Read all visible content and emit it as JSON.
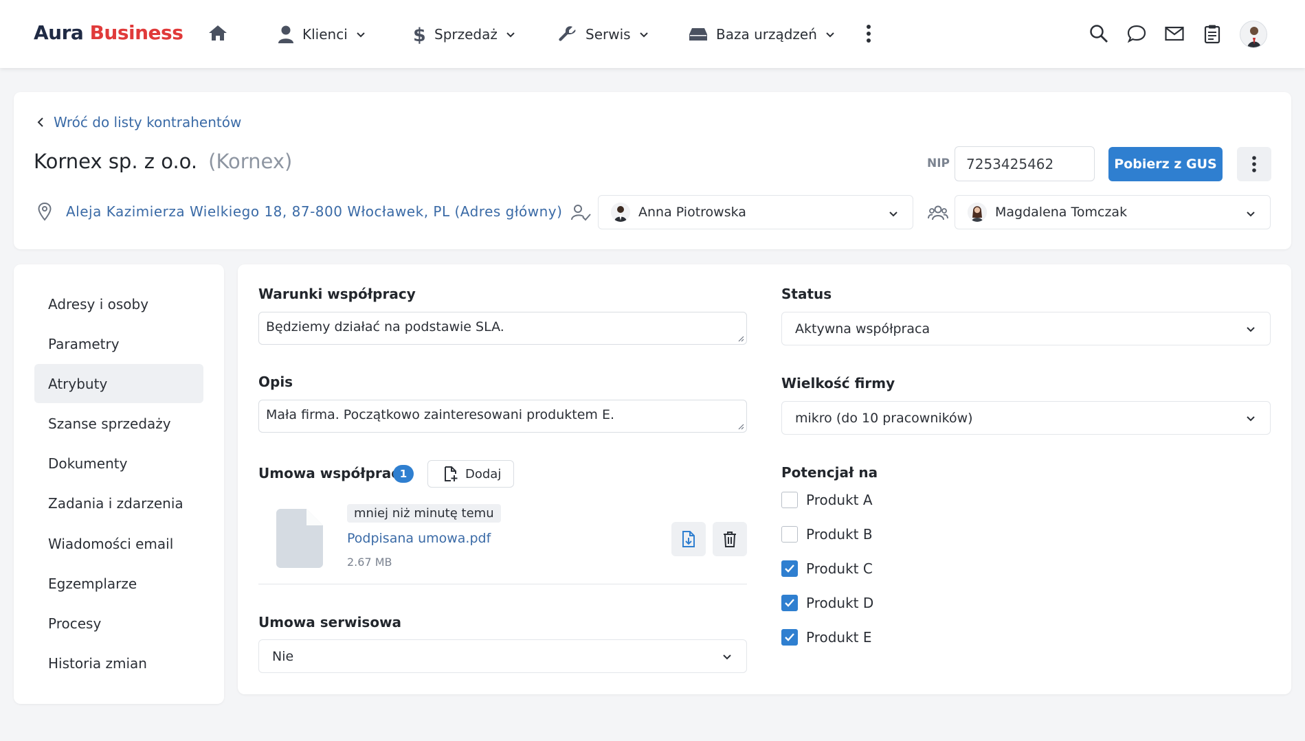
{
  "brand": {
    "name_part1": "Aura",
    "name_part2": "Business"
  },
  "nav": {
    "items": [
      {
        "label": "Klienci"
      },
      {
        "label": "Sprzedaż"
      },
      {
        "label": "Serwis"
      },
      {
        "label": "Baza urządzeń"
      }
    ]
  },
  "header": {
    "back_link": "Wróć do listy kontrahentów",
    "company_name": "Kornex sp. z o.o.",
    "company_short": "(Kornex)",
    "nip_label": "NIP",
    "nip_value": "7253425462",
    "fetch_button": "Pobierz z GUS",
    "address": "Aleja Kazimierza Wielkiego 18, 87-800 Włocławek, PL (Adres główny)",
    "owner": "Anna Piotrowska",
    "team_member": "Magdalena Tomczak"
  },
  "sidebar": {
    "items": [
      {
        "label": "Adresy i osoby"
      },
      {
        "label": "Parametry"
      },
      {
        "label": "Atrybuty"
      },
      {
        "label": "Szanse sprzedaży"
      },
      {
        "label": "Dokumenty"
      },
      {
        "label": "Zadania i zdarzenia"
      },
      {
        "label": "Wiadomości email"
      },
      {
        "label": "Egzemplarze"
      },
      {
        "label": "Procesy"
      },
      {
        "label": "Historia zmian"
      }
    ],
    "active": "Atrybuty"
  },
  "form": {
    "terms_label": "Warunki współpracy",
    "terms_value": "Będziemy działać na podstawie SLA.",
    "desc_label": "Opis",
    "desc_value": "Mała firma. Początkowo zainteresowani produktem E.",
    "contract_label": "Umowa współpracy",
    "contract_count": "1",
    "add_button": "Dodaj",
    "file": {
      "time": "mniej niż minutę temu",
      "name": "Podpisana umowa.pdf",
      "size": "2.67 MB"
    },
    "service_label": "Umowa serwisowa",
    "service_value": "Nie",
    "status_label": "Status",
    "status_value": "Aktywna współpraca",
    "size_label": "Wielkość firmy",
    "size_value": "mikro (do 10 pracowników)",
    "potential_label": "Potencjał na",
    "potential": [
      {
        "label": "Produkt A",
        "checked": false
      },
      {
        "label": "Produkt B",
        "checked": false
      },
      {
        "label": "Produkt C",
        "checked": true
      },
      {
        "label": "Produkt D",
        "checked": true
      },
      {
        "label": "Produkt E",
        "checked": true
      }
    ]
  },
  "colors": {
    "accent": "#2f7fd0",
    "brand_red": "#e03a3a",
    "brand_dark": "#1f2a44",
    "link": "#3a6aa6"
  }
}
